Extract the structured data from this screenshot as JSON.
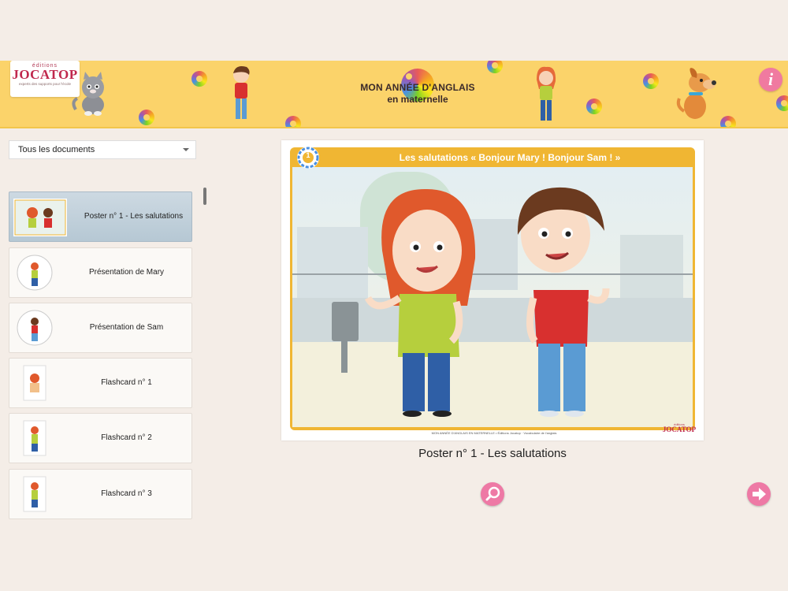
{
  "header": {
    "logo_small": "éditions",
    "logo_brand": "JOCATOP",
    "logo_tagline": "experts des supports pour l'école",
    "title_line1": "MON ANNÉE D'ANGLAIS",
    "title_line2": "en maternelle",
    "info_icon": "info-icon",
    "info_symbol": "i"
  },
  "filter": {
    "selected": "Tous les documents"
  },
  "documents": [
    {
      "label": "Poster n° 1 - Les salutations",
      "selected": true
    },
    {
      "label": "Présentation de Mary"
    },
    {
      "label": "Présentation de Sam"
    },
    {
      "label": "Flashcard n° 1"
    },
    {
      "label": "Flashcard n° 2"
    },
    {
      "label": "Flashcard n° 3"
    }
  ],
  "poster": {
    "badge_number": "1",
    "title": "Les salutations « Bonjour Mary ! Bonjour Sam ! »",
    "footer_text": "MON ANNÉE D'ANGLAIS EN MATERNELLE  •  Éditions Jocatop  ·  Vocabulaire de l'anglais",
    "footer_logo_small": "éditions",
    "footer_logo_brand": "JOCATOP",
    "caption": "Poster n° 1 - Les salutations"
  },
  "buttons": {
    "zoom_icon": "magnifier-icon",
    "next_icon": "arrow-right-icon"
  },
  "colors": {
    "banner": "#fbd36a",
    "accent_pink": "#ee79a5",
    "poster_header": "#f0b633",
    "background": "#f4ede7"
  }
}
